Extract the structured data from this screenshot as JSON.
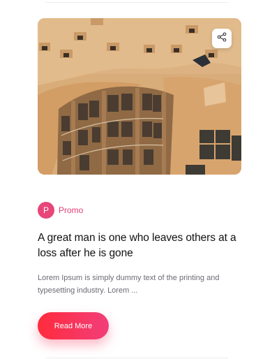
{
  "post": {
    "image_alt": "Casa Mila courtyard",
    "category": {
      "initial": "P",
      "label": "Promo",
      "color": "#e8457a"
    },
    "title": "A great man is one who leaves others at a loss after he is gone",
    "excerpt": "Lorem Ipsum is simply dummy text of the printing and typesetting industry. Lorem ...",
    "read_more_label": "Read More",
    "share_icon": "share-icon"
  },
  "colors": {
    "accent_start": "#ff2b3c",
    "accent_end": "#f23e7a",
    "title_text": "#111111",
    "excerpt_text": "#6b6b73"
  }
}
